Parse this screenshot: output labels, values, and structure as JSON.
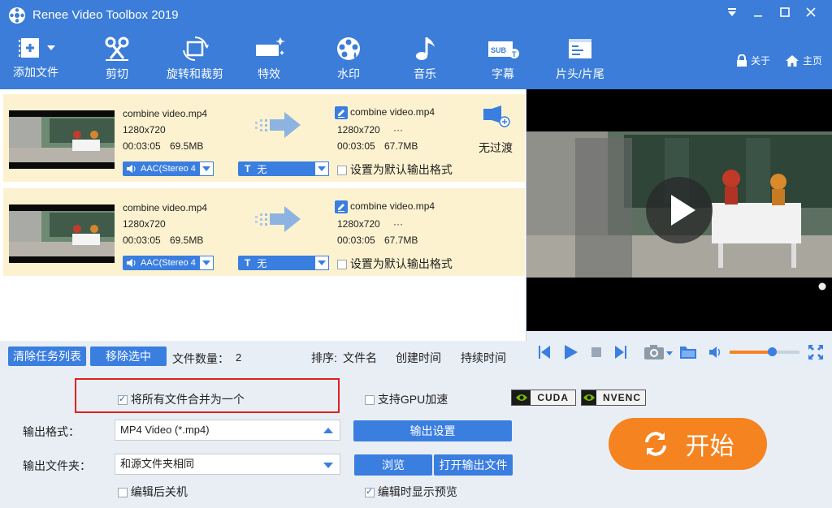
{
  "window": {
    "title": "Renee Video Toolbox 2019"
  },
  "toolbar": {
    "tools": [
      "添加文件",
      "剪切",
      "旋转和裁剪",
      "特效",
      "水印",
      "音乐",
      "字幕",
      "片头/片尾"
    ],
    "about": "关于",
    "home": "主页"
  },
  "tasks": [
    {
      "src_name": "combine video.mp4",
      "src_res": "1280x720",
      "src_dur": "00:03:05",
      "src_size": "69.5MB",
      "out_name": "combine video.mp4",
      "out_res": "1280x720",
      "out_more": "···",
      "out_dur": "00:03:05",
      "out_size": "67.7MB",
      "audio": "AAC(Stereo 4",
      "subtitle": "无",
      "default_label": "设置为默认输出格式",
      "transition": "无过渡"
    },
    {
      "src_name": "combine video.mp4",
      "src_res": "1280x720",
      "src_dur": "00:03:05",
      "src_size": "69.5MB",
      "out_name": "combine video.mp4",
      "out_res": "1280x720",
      "out_more": "···",
      "out_dur": "00:03:05",
      "out_size": "67.7MB",
      "audio": "AAC(Stereo 4",
      "subtitle": "无",
      "default_label": "设置为默认输出格式"
    }
  ],
  "listbar": {
    "clear": "清除任务列表",
    "remove": "移除选中",
    "count_label": "文件数量：",
    "count": "2",
    "sort_label": "排序:",
    "sort_name": "文件名",
    "sort_created": "创建时间",
    "sort_duration": "持续时间"
  },
  "player": {
    "volume": 0.6
  },
  "settings": {
    "merge_label": "将所有文件合并为一个",
    "merge_checked": true,
    "gpu_label": "支持GPU加速",
    "gpu_checked": false,
    "cuda": "CUDA",
    "nvenc": "NVENC",
    "format_label": "输出格式：",
    "format_value": "MP4 Video (*.mp4)",
    "output_settings": "输出设置",
    "folder_label": "输出文件夹：",
    "folder_value": "和源文件夹相同",
    "browse": "浏览",
    "open_output": "打开输出文件",
    "shutdown_label": "编辑后关机",
    "shutdown_checked": false,
    "preview_label": "编辑时显示预览",
    "preview_checked": true,
    "start": "开始"
  },
  "colors": {
    "brand": "#3b7dd8",
    "accent": "#f5831f",
    "task_bg": "#fdf2d0",
    "highlight_border": "#e02020"
  }
}
